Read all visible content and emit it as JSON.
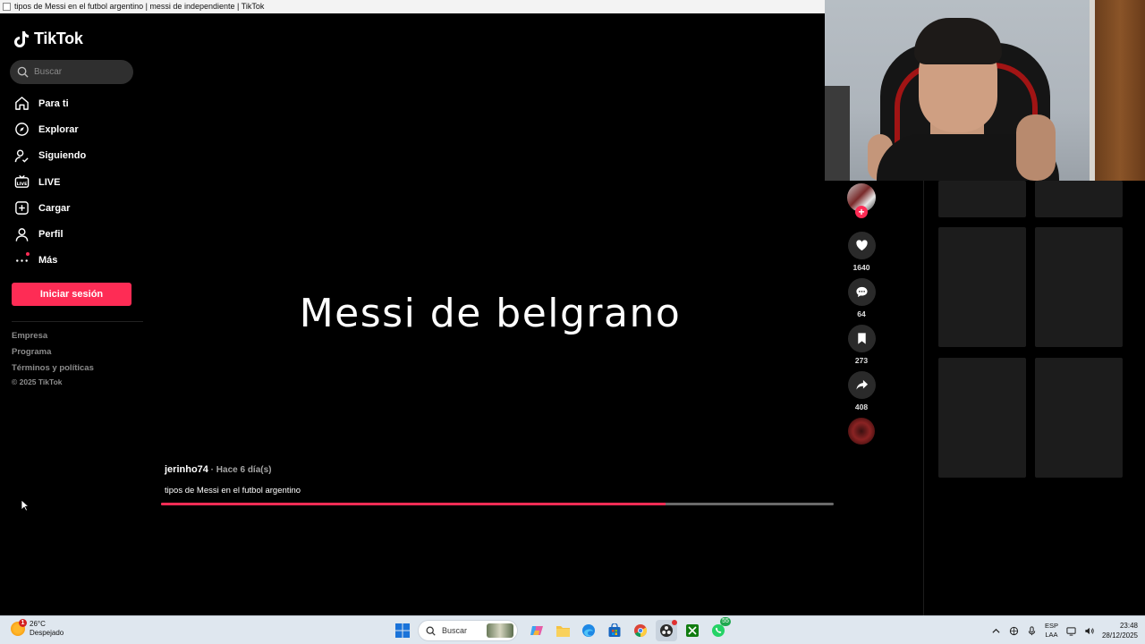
{
  "window": {
    "title": "tipos de Messi en el futbol argentino | messi de independiente | TikTok"
  },
  "sidebar": {
    "logo": "TikTok",
    "search": {
      "placeholder": "Buscar"
    },
    "nav": [
      {
        "label": "Para ti",
        "icon": "home-icon"
      },
      {
        "label": "Explorar",
        "icon": "compass-icon"
      },
      {
        "label": "Siguiendo",
        "icon": "following-icon"
      },
      {
        "label": "LIVE",
        "icon": "live-icon"
      },
      {
        "label": "Cargar",
        "icon": "upload-icon"
      },
      {
        "label": "Perfil",
        "icon": "profile-icon"
      },
      {
        "label": "Más",
        "icon": "more-icon"
      }
    ],
    "login_button": "Iniciar sesión",
    "footer": {
      "links": [
        "Empresa",
        "Programa",
        "Términos y políticas"
      ],
      "copyright": "© 2025 TikTok"
    }
  },
  "video": {
    "overlay_text": "Messi de belgrano",
    "author": "jerinho74",
    "time_ago": " · Hace 6 día(s)",
    "description": "tipos de Messi en el futbol argentino",
    "progress": 0.75
  },
  "actions": {
    "likes": "1640",
    "comments": "64",
    "saves": "273",
    "shares": "408"
  },
  "taskbar": {
    "weather": {
      "temp": "26°C",
      "condition": "Despejado",
      "badge": "1"
    },
    "search_label": "Buscar",
    "whatsapp_badge": "55",
    "language": {
      "line1": "ESP",
      "line2": "LAA"
    },
    "clock": {
      "time": "23:48",
      "date": "28/12/2025"
    }
  },
  "colors": {
    "accent": "#fe2c55",
    "background": "#000000",
    "sidebar_search_bg": "#2f2f2f",
    "action_button_bg": "#2a2a2a",
    "taskbar_bg": "#dfe7ef"
  }
}
